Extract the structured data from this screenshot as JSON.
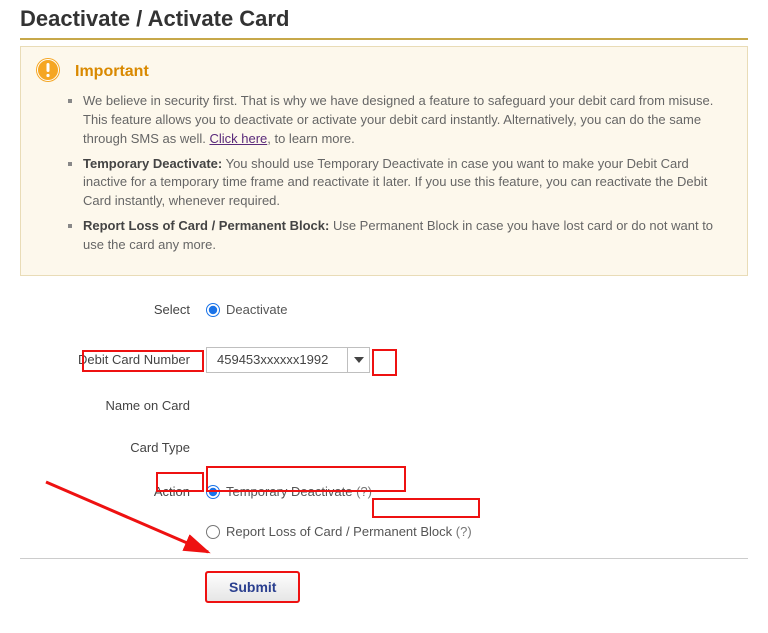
{
  "title": "Deactivate / Activate Card",
  "important": {
    "heading": "Important",
    "bullets": [
      {
        "pre": "We believe in security first. That is why we have designed a feature to safeguard your debit card from misuse. This feature allows you to deactivate or activate your debit card instantly. Alternatively, you can do the same through SMS as well. ",
        "link": "Click here",
        "post": ", to learn more."
      },
      {
        "bold": "Temporary Deactivate:",
        "text": " You should use Temporary Deactivate in case you want to make your Debit Card inactive for a temporary time frame and reactivate it later. If you use this feature, you can reactivate the Debit Card instantly, whenever required."
      },
      {
        "bold": "Report Loss of Card / Permanent Block:",
        "text": " Use Permanent Block in case you have lost card or do not want to use the card any more."
      }
    ]
  },
  "form": {
    "select_label": "Select",
    "select_option": "Deactivate",
    "card_number_label": "Debit Card Number",
    "card_number_value": "459453xxxxxx1992",
    "name_label": "Name on Card",
    "type_label": "Card Type",
    "action_label": "Action",
    "action_temp": "Temporary Deactivate",
    "action_perm_pre": "Report Loss of Card / ",
    "action_perm_highlight": "Permanent Block",
    "qmark": "(?)",
    "submit": "Submit"
  }
}
